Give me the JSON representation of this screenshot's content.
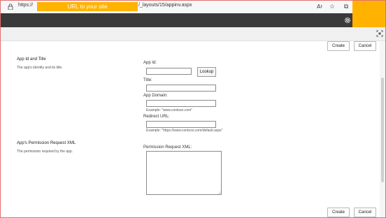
{
  "browser": {
    "url_start": "https://",
    "url_highlight": "URL to your site",
    "url_end": "/_layouts/15/appinv.aspx",
    "icons": [
      "lock-icon",
      "read-aloud-icon",
      "favorite-star-icon",
      "favorites-bar-icon",
      "collections-icon"
    ]
  },
  "suitebar": {
    "icons": [
      "gear-icon"
    ]
  },
  "ribbon": {
    "icons": [
      "focus-mode-icon"
    ]
  },
  "actions": {
    "create_label": "Create",
    "cancel_label": "Cancel"
  },
  "app_section": {
    "title": "App Id and Title",
    "description": "The app's identity and its title.",
    "app_id_label": "App Id:",
    "app_id_value": "",
    "lookup_label": "Lookup",
    "title_label": "Title:",
    "title_value": "",
    "domain_label": "App Domain:",
    "domain_value": "",
    "domain_example": "Example: \"www.contoso.com\"",
    "redirect_label": "Redirect URL:",
    "redirect_value": "",
    "redirect_example": "Example: \"https://www.contoso.com/default.aspx\""
  },
  "permission_section": {
    "title": "App's Permission Request XML",
    "description": "The permission required by the app.",
    "xml_label": "Permission Request XML:",
    "xml_value": ""
  },
  "colors": {
    "highlight": "#ffb300",
    "suitebar": "#3a3a3a",
    "frame_border": "#e07070"
  }
}
